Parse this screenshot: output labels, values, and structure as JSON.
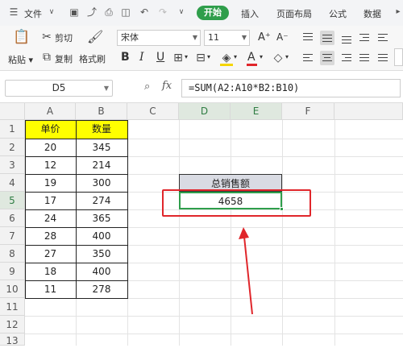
{
  "menubar": {
    "file": "文件",
    "start": "开始",
    "insert": "插入",
    "page_layout": "页面布局",
    "formulas": "公式",
    "data": "数据"
  },
  "ribbon": {
    "paste": "粘贴",
    "cut": "剪切",
    "copy": "复制",
    "format_painter": "格式刷",
    "font_name": "宋体",
    "font_size": "11",
    "grow_font": "A⁺",
    "shrink_font": "A⁻",
    "bold": "B",
    "italic": "I",
    "underline": "U",
    "font_color_glyph": "A"
  },
  "formula_bar": {
    "name_box": "D5",
    "fx": "fx",
    "formula": "=SUM(A2:A10*B2:B10)"
  },
  "sheet": {
    "columns": [
      "A",
      "B",
      "C",
      "D",
      "E",
      "F"
    ],
    "rows": [
      "1",
      "2",
      "3",
      "4",
      "5",
      "6",
      "7",
      "8",
      "9",
      "10",
      "11",
      "12",
      "13"
    ],
    "header_a": "单价",
    "header_b": "数量",
    "a_values": [
      "20",
      "12",
      "19",
      "17",
      "24",
      "28",
      "27",
      "18",
      "11"
    ],
    "b_values": [
      "345",
      "214",
      "300",
      "274",
      "365",
      "400",
      "350",
      "400",
      "278"
    ],
    "d4_label": "总销售额",
    "d5_value": "4658"
  },
  "colors": {
    "header_fill": "#ffff00",
    "label_fill": "#d9dbe3",
    "active_green": "#2f9e4b",
    "annotation_red": "#e0262b"
  }
}
